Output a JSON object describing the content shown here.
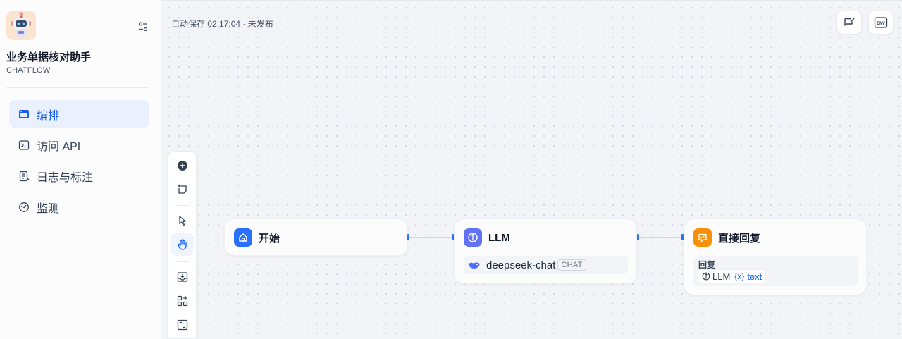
{
  "app": {
    "name": "业务单据核对助手",
    "mode": "CHATFLOW",
    "icon": "robot-icon"
  },
  "nav": {
    "items": [
      {
        "label": "编排",
        "icon": "layout-icon",
        "active": true
      },
      {
        "label": "访问 API",
        "icon": "terminal-icon",
        "active": false
      },
      {
        "label": "日志与标注",
        "icon": "file-text-icon",
        "active": false
      },
      {
        "label": "监测",
        "icon": "gauge-icon",
        "active": false
      }
    ]
  },
  "header": {
    "autosave": "自动保存 02:17:04 · 未发布",
    "buttons": [
      {
        "icon": "chat-check-icon"
      },
      {
        "icon": "env-icon",
        "label": "ENV"
      }
    ]
  },
  "toolbar": {
    "tools": [
      "add-node-icon",
      "add-note-icon",
      "pointer-icon",
      "hand-icon",
      "export-image-icon",
      "organize-icon",
      "fit-view-icon"
    ],
    "active_tool": "hand-icon"
  },
  "nodes": {
    "start": {
      "title": "开始",
      "icon": "home-icon",
      "color": "#2970ff"
    },
    "llm": {
      "title": "LLM",
      "icon": "llm-icon",
      "color": "#6172f3",
      "model": "deepseek-chat",
      "model_mode": "CHAT"
    },
    "answer": {
      "title": "直接回复",
      "icon": "answer-icon",
      "color": "#f79009",
      "field_label": "回复",
      "var_node": "LLM",
      "var_symbol": "{x}",
      "var_name": "text"
    }
  },
  "colors": {
    "accent": "#155eef",
    "handle": "#2970ff"
  }
}
